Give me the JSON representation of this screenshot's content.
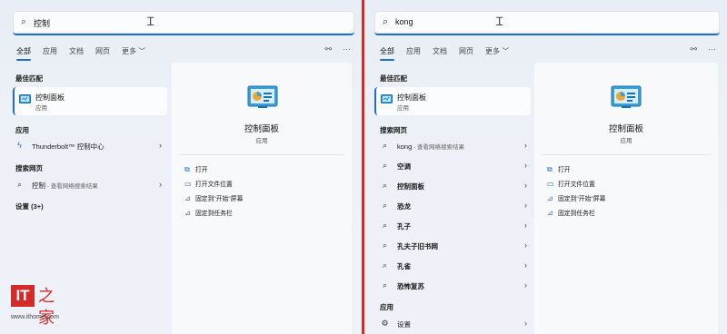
{
  "left": {
    "search_query": "控制",
    "tabs": [
      "全部",
      "应用",
      "文档",
      "网页",
      "更多 ﹀"
    ],
    "section_best": "最佳匹配",
    "best_title": "控制面板",
    "best_sub": "应用",
    "section_apps": "应用",
    "apps": [
      {
        "label": "Thunderbolt™ 控制中心"
      }
    ],
    "section_web": "搜索网页",
    "web": [
      {
        "label": "控制",
        "sub": " - 查看网络搜索结果"
      }
    ],
    "section_settings": "设置 (3+)",
    "pane": {
      "title": "控制面板",
      "subtitle": "应用",
      "actions": [
        "打开",
        "打开文件位置",
        "固定到\"开始\"屏幕",
        "固定到任务栏"
      ]
    }
  },
  "right": {
    "search_query": "kong",
    "tabs": [
      "全部",
      "应用",
      "文档",
      "网页",
      "更多 ﹀"
    ],
    "section_best": "最佳匹配",
    "best_title": "控制面板",
    "best_sub": "应用",
    "section_web": "搜索网页",
    "web": [
      {
        "label": "kong",
        "sub": " - 查看网络搜索结果"
      },
      {
        "label": "空调"
      },
      {
        "label": "控制面板"
      },
      {
        "label": "恐龙"
      },
      {
        "label": "孔子"
      },
      {
        "label": "孔夫子旧书网"
      },
      {
        "label": "孔雀"
      },
      {
        "label": "恐怖复苏"
      }
    ],
    "section_apps": "应用",
    "apps": [
      {
        "label": "设置"
      }
    ],
    "pane": {
      "title": "控制面板",
      "subtitle": "应用",
      "actions": [
        "打开",
        "打开文件位置",
        "固定到\"开始\"屏幕",
        "固定到任务栏"
      ]
    }
  },
  "watermark": {
    "logo_text": "IT之家",
    "url": "www.ithome.com"
  },
  "colors": {
    "accent": "#1f6fd1",
    "divider": "#d42a2a",
    "brand": "#d32a2a"
  }
}
